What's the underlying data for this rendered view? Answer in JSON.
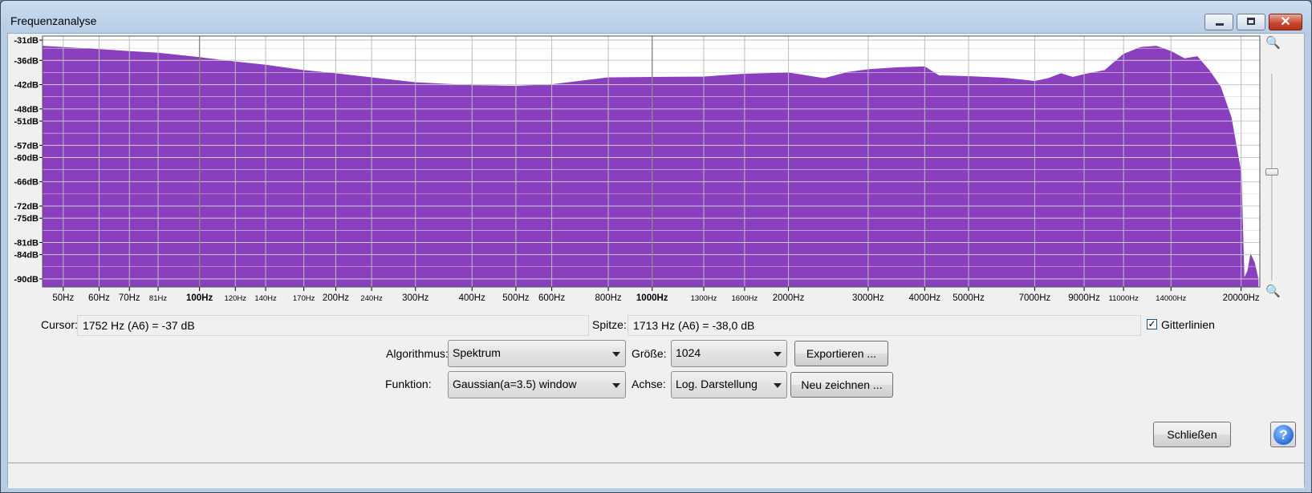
{
  "window": {
    "title": "Frequenzanalyse"
  },
  "plot": {
    "ylabels": [
      "-31dB",
      "-36dB",
      "-42dB",
      "-48dB",
      "-51dB",
      "-57dB",
      "-60dB",
      "-66dB",
      "-72dB",
      "-75dB",
      "-81dB",
      "-84dB",
      "-90dB"
    ],
    "xlabels": [
      {
        "t": "50Hz",
        "f": 50,
        "big": false
      },
      {
        "t": "60Hz",
        "f": 60,
        "big": false
      },
      {
        "t": "70Hz",
        "f": 70,
        "big": false
      },
      {
        "t": "81Hz",
        "f": 81,
        "big": false,
        "small": true
      },
      {
        "t": "100Hz",
        "f": 100,
        "big": true
      },
      {
        "t": "120Hz",
        "f": 120,
        "small": true
      },
      {
        "t": "140Hz",
        "f": 140,
        "small": true
      },
      {
        "t": "170Hz",
        "f": 170,
        "small": true
      },
      {
        "t": "200Hz",
        "f": 200
      },
      {
        "t": "240Hz",
        "f": 240,
        "small": true
      },
      {
        "t": "300Hz",
        "f": 300
      },
      {
        "t": "400Hz",
        "f": 400
      },
      {
        "t": "500Hz",
        "f": 500
      },
      {
        "t": "600Hz",
        "f": 600
      },
      {
        "t": "800Hz",
        "f": 800
      },
      {
        "t": "1000Hz",
        "f": 1000,
        "big": true
      },
      {
        "t": "1300Hz",
        "f": 1300,
        "small": true
      },
      {
        "t": "1600Hz",
        "f": 1600,
        "small": true
      },
      {
        "t": "2000Hz",
        "f": 2000
      },
      {
        "t": "3000Hz",
        "f": 3000
      },
      {
        "t": "4000Hz",
        "f": 4000
      },
      {
        "t": "5000Hz",
        "f": 5000
      },
      {
        "t": "7000Hz",
        "f": 7000
      },
      {
        "t": "9000Hz",
        "f": 9000
      },
      {
        "t": "11000Hz",
        "f": 11000,
        "small": true
      },
      {
        "t": "14000Hz",
        "f": 14000,
        "small": true
      },
      {
        "t": "20000Hz",
        "f": 20000
      }
    ],
    "fill_color": "#8a3fbf"
  },
  "chart_data": {
    "type": "area",
    "xscale": "log",
    "xlim": [
      45,
      22000
    ],
    "ylim": [
      -92,
      -30
    ],
    "grid": true,
    "x": [
      45,
      50,
      60,
      70,
      81,
      100,
      120,
      140,
      170,
      200,
      240,
      300,
      400,
      500,
      600,
      700,
      800,
      1000,
      1300,
      1600,
      2000,
      2400,
      2700,
      3000,
      3500,
      4000,
      4300,
      5000,
      6000,
      7000,
      7500,
      8000,
      8500,
      9000,
      10000,
      11000,
      12000,
      13000,
      14000,
      15000,
      16000,
      17000,
      18000,
      19000,
      20000,
      20300,
      20700,
      21000,
      21400,
      21800
    ],
    "y": [
      -32.5,
      -32.8,
      -33.3,
      -33.8,
      -34.2,
      -35.3,
      -36.4,
      -37.2,
      -38.5,
      -39.3,
      -40.3,
      -41.5,
      -42.2,
      -42.4,
      -42,
      -41.1,
      -40.3,
      -40.2,
      -40.1,
      -39.4,
      -39.1,
      -40.5,
      -39.0,
      -38.3,
      -37.8,
      -37.6,
      -39.8,
      -40,
      -40.4,
      -41.2,
      -40.5,
      -39.3,
      -40.2,
      -39.5,
      -38.5,
      -34.5,
      -32.8,
      -32.5,
      -33.8,
      -35.6,
      -35.1,
      -38.5,
      -42.5,
      -50,
      -64,
      -90,
      -88,
      -84,
      -86,
      -90
    ]
  },
  "cursor": {
    "label": "Cursor:",
    "value": "1752 Hz (A6) = -37 dB"
  },
  "peak": {
    "label": "Spitze:",
    "value": "1713 Hz (A6) = -38,0 dB"
  },
  "grid_toggle": {
    "label": "Gitterlinien",
    "checked": true
  },
  "algorithm": {
    "label": "Algorithmus:",
    "value": "Spektrum"
  },
  "function": {
    "label": "Funktion:",
    "value": "Gaussian(a=3.5) window"
  },
  "size": {
    "label": "Größe:",
    "value": "1024"
  },
  "axis": {
    "label": "Achse:",
    "value": "Log. Darstellung"
  },
  "buttons": {
    "export": "Exportieren ...",
    "redraw": "Neu zeichnen ...",
    "close": "Schließen",
    "help": "?"
  }
}
